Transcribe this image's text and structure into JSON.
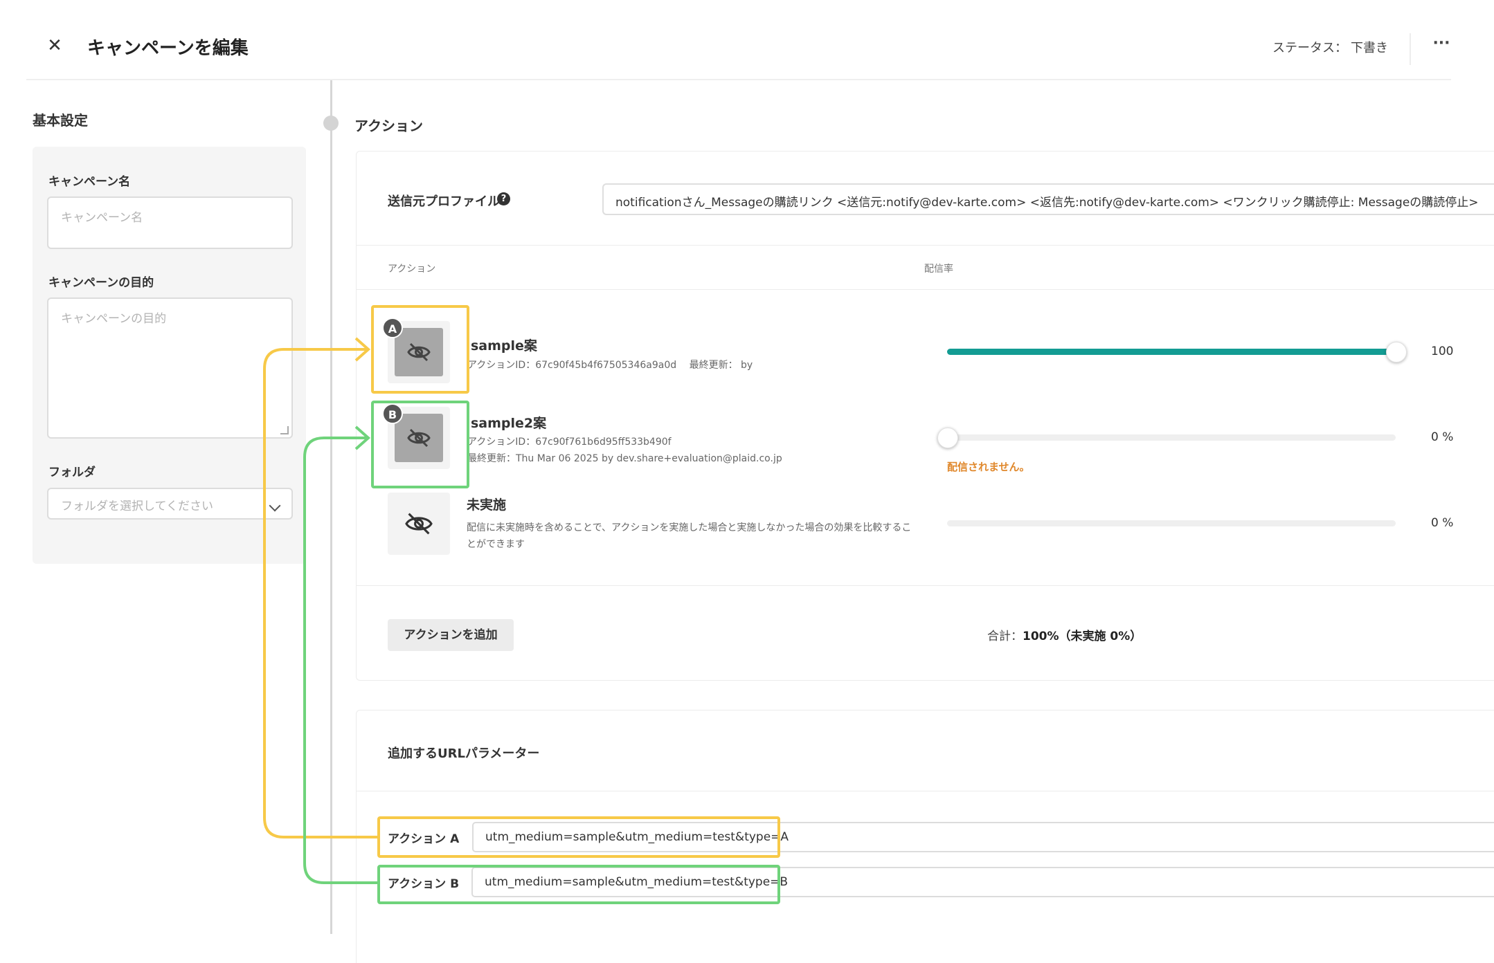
{
  "header": {
    "title": "キャンペーンを編集",
    "close_icon": "close-icon",
    "status_label": "ステータス：",
    "status_value": "下書き",
    "more_icon": "more-icon"
  },
  "sidebar": {
    "title": "基本設定",
    "campaign_name": {
      "label": "キャンペーン名",
      "placeholder": "キャンペーン名",
      "value": ""
    },
    "campaign_goal": {
      "label": "キャンペーンの目的",
      "placeholder": "キャンペーンの目的",
      "value": ""
    },
    "folder": {
      "label": "フォルダ",
      "placeholder": "フォルダを選択してください"
    }
  },
  "action_section": {
    "title": "アクション",
    "sender_profile": {
      "label": "送信元プロファイル",
      "value": "notificationさん_Messageの購読リンク <送信元:notify@dev-karte.com> <返信先:notify@dev-karte.com> <ワンクリック購読停止: Messageの購読停止>"
    },
    "columns": {
      "action": "アクション",
      "rate": "配信率"
    },
    "actions": [
      {
        "badge": "A",
        "name": "sample案",
        "meta1": "アクションID：67c90f45b4f67505346a9a0d　 最終更新： by",
        "meta2": "",
        "rate": 100,
        "rate_text": "100",
        "warning": ""
      },
      {
        "badge": "B",
        "name": "sample2案",
        "meta1": "アクションID：67c90f761b6d95ff533b490f",
        "meta2": "最終更新：Thu Mar 06 2025 by dev.share+evaluation@plaid.co.jp",
        "rate": 0,
        "rate_text": "0 %",
        "warning": "配信されません。"
      }
    ],
    "control": {
      "name": "未実施",
      "desc1": "配信に未実施時を含めることで、アクションを実施した場合と実施しなかった場合の効果を比較するこ",
      "desc2": "とができます",
      "rate": 0,
      "rate_text": "0 %"
    },
    "add_button": "アクションを追加",
    "total_prefix": "合計：",
    "total_value": "100%（未実施 0%）"
  },
  "url_params": {
    "title": "追加するURLパラメーター",
    "rows": [
      {
        "label": "アクション A",
        "value": "utm_medium=sample&utm_medium=test&type=A"
      },
      {
        "label": "アクション B",
        "value": "utm_medium=sample&utm_medium=test&type=B"
      }
    ]
  },
  "annotations": {
    "yellow": "#f7c948",
    "green": "#6fd37b"
  },
  "colors": {
    "slider_fill": "#139c93",
    "warning": "#e0882c"
  }
}
